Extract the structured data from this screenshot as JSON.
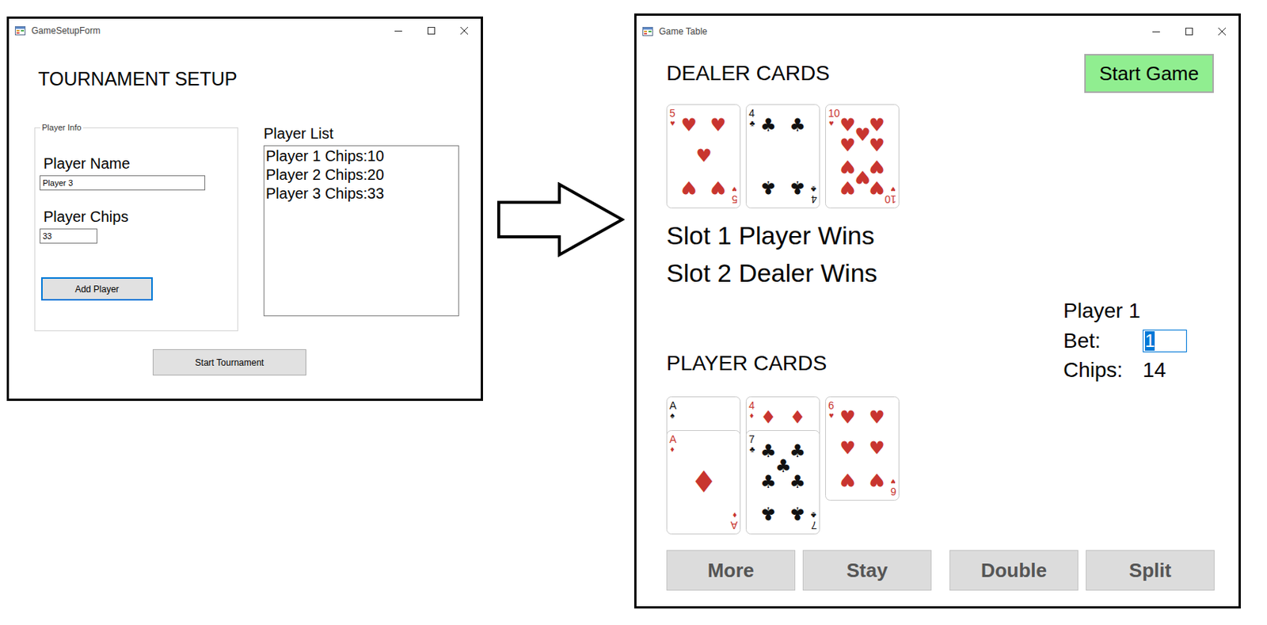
{
  "setup_window": {
    "title": "GameSetupForm",
    "heading": "TOURNAMENT SETUP",
    "player_info": {
      "label": "Player Info",
      "name_label": "Player Name",
      "name_value": "Player 3",
      "chips_label": "Player Chips",
      "chips_value": "33",
      "add_button": "Add Player"
    },
    "player_list": {
      "label": "Player List",
      "items": [
        "Player 1 Chips:10",
        "Player 2 Chips:20",
        "Player 3 Chips:33"
      ]
    },
    "start_button": "Start Tournament"
  },
  "table_window": {
    "title": "Game Table",
    "dealer": {
      "label": "DEALER CARDS",
      "cards": [
        {
          "rank": "5",
          "suit": "♥",
          "color": "#c8352f"
        },
        {
          "rank": "4",
          "suit": "♣",
          "color": "#111111"
        },
        {
          "rank": "10",
          "suit": "♥",
          "color": "#c8352f"
        }
      ]
    },
    "start_button": "Start Game",
    "results": [
      "Slot 1 Player Wins",
      "Slot 2 Dealer Wins"
    ],
    "player_info": {
      "name": "Player 1",
      "bet_label": "Bet:",
      "bet_value": "1",
      "bet_selected": true,
      "chips_label": "Chips:",
      "chips_value": "14"
    },
    "player": {
      "label": "PLAYER CARDS",
      "hands": [
        {
          "cards": [
            {
              "rank": "A",
              "suit": "♠",
              "color": "#111111"
            },
            {
              "rank": "A",
              "suit": "♦",
              "color": "#c8352f"
            }
          ]
        },
        {
          "cards": [
            {
              "rank": "4",
              "suit": "♦",
              "color": "#c8352f"
            },
            {
              "rank": "7",
              "suit": "♣",
              "color": "#111111"
            }
          ]
        },
        {
          "cards": [
            {
              "rank": "6",
              "suit": "♥",
              "color": "#c8352f"
            }
          ]
        }
      ]
    },
    "buttons": [
      "More",
      "Stay",
      "Double",
      "Split"
    ]
  }
}
